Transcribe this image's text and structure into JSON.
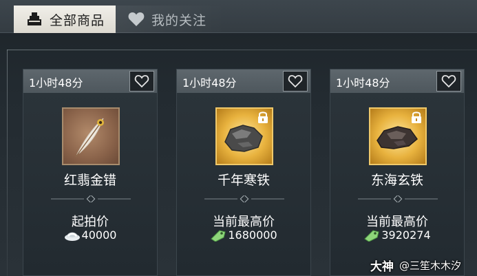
{
  "tabs": {
    "all_label": "全部商品",
    "fav_label": "我的关注"
  },
  "items": [
    {
      "timer": "1小时48分",
      "name": "红翡金错",
      "price_label": "起拍价",
      "price": "40000",
      "currency_icon": "silver-ingot-icon",
      "locked": false
    },
    {
      "timer": "1小时48分",
      "name": "千年寒铁",
      "price_label": "当前最高价",
      "price": "1680000",
      "currency_icon": "jade-ticket-icon",
      "locked": true
    },
    {
      "timer": "1小时48分",
      "name": "东海玄铁",
      "price_label": "当前最高价",
      "price": "3920274",
      "currency_icon": "jade-ticket-icon",
      "locked": true
    }
  ],
  "watermark": {
    "brand": "大神",
    "author": "@三笙木木汐"
  },
  "colors": {
    "background": "#232b31",
    "tab_active": "#e8e6df",
    "card_header": "#565f65",
    "gold_frame": "#f0c96a",
    "ticket_green": "#7ccf6a"
  }
}
